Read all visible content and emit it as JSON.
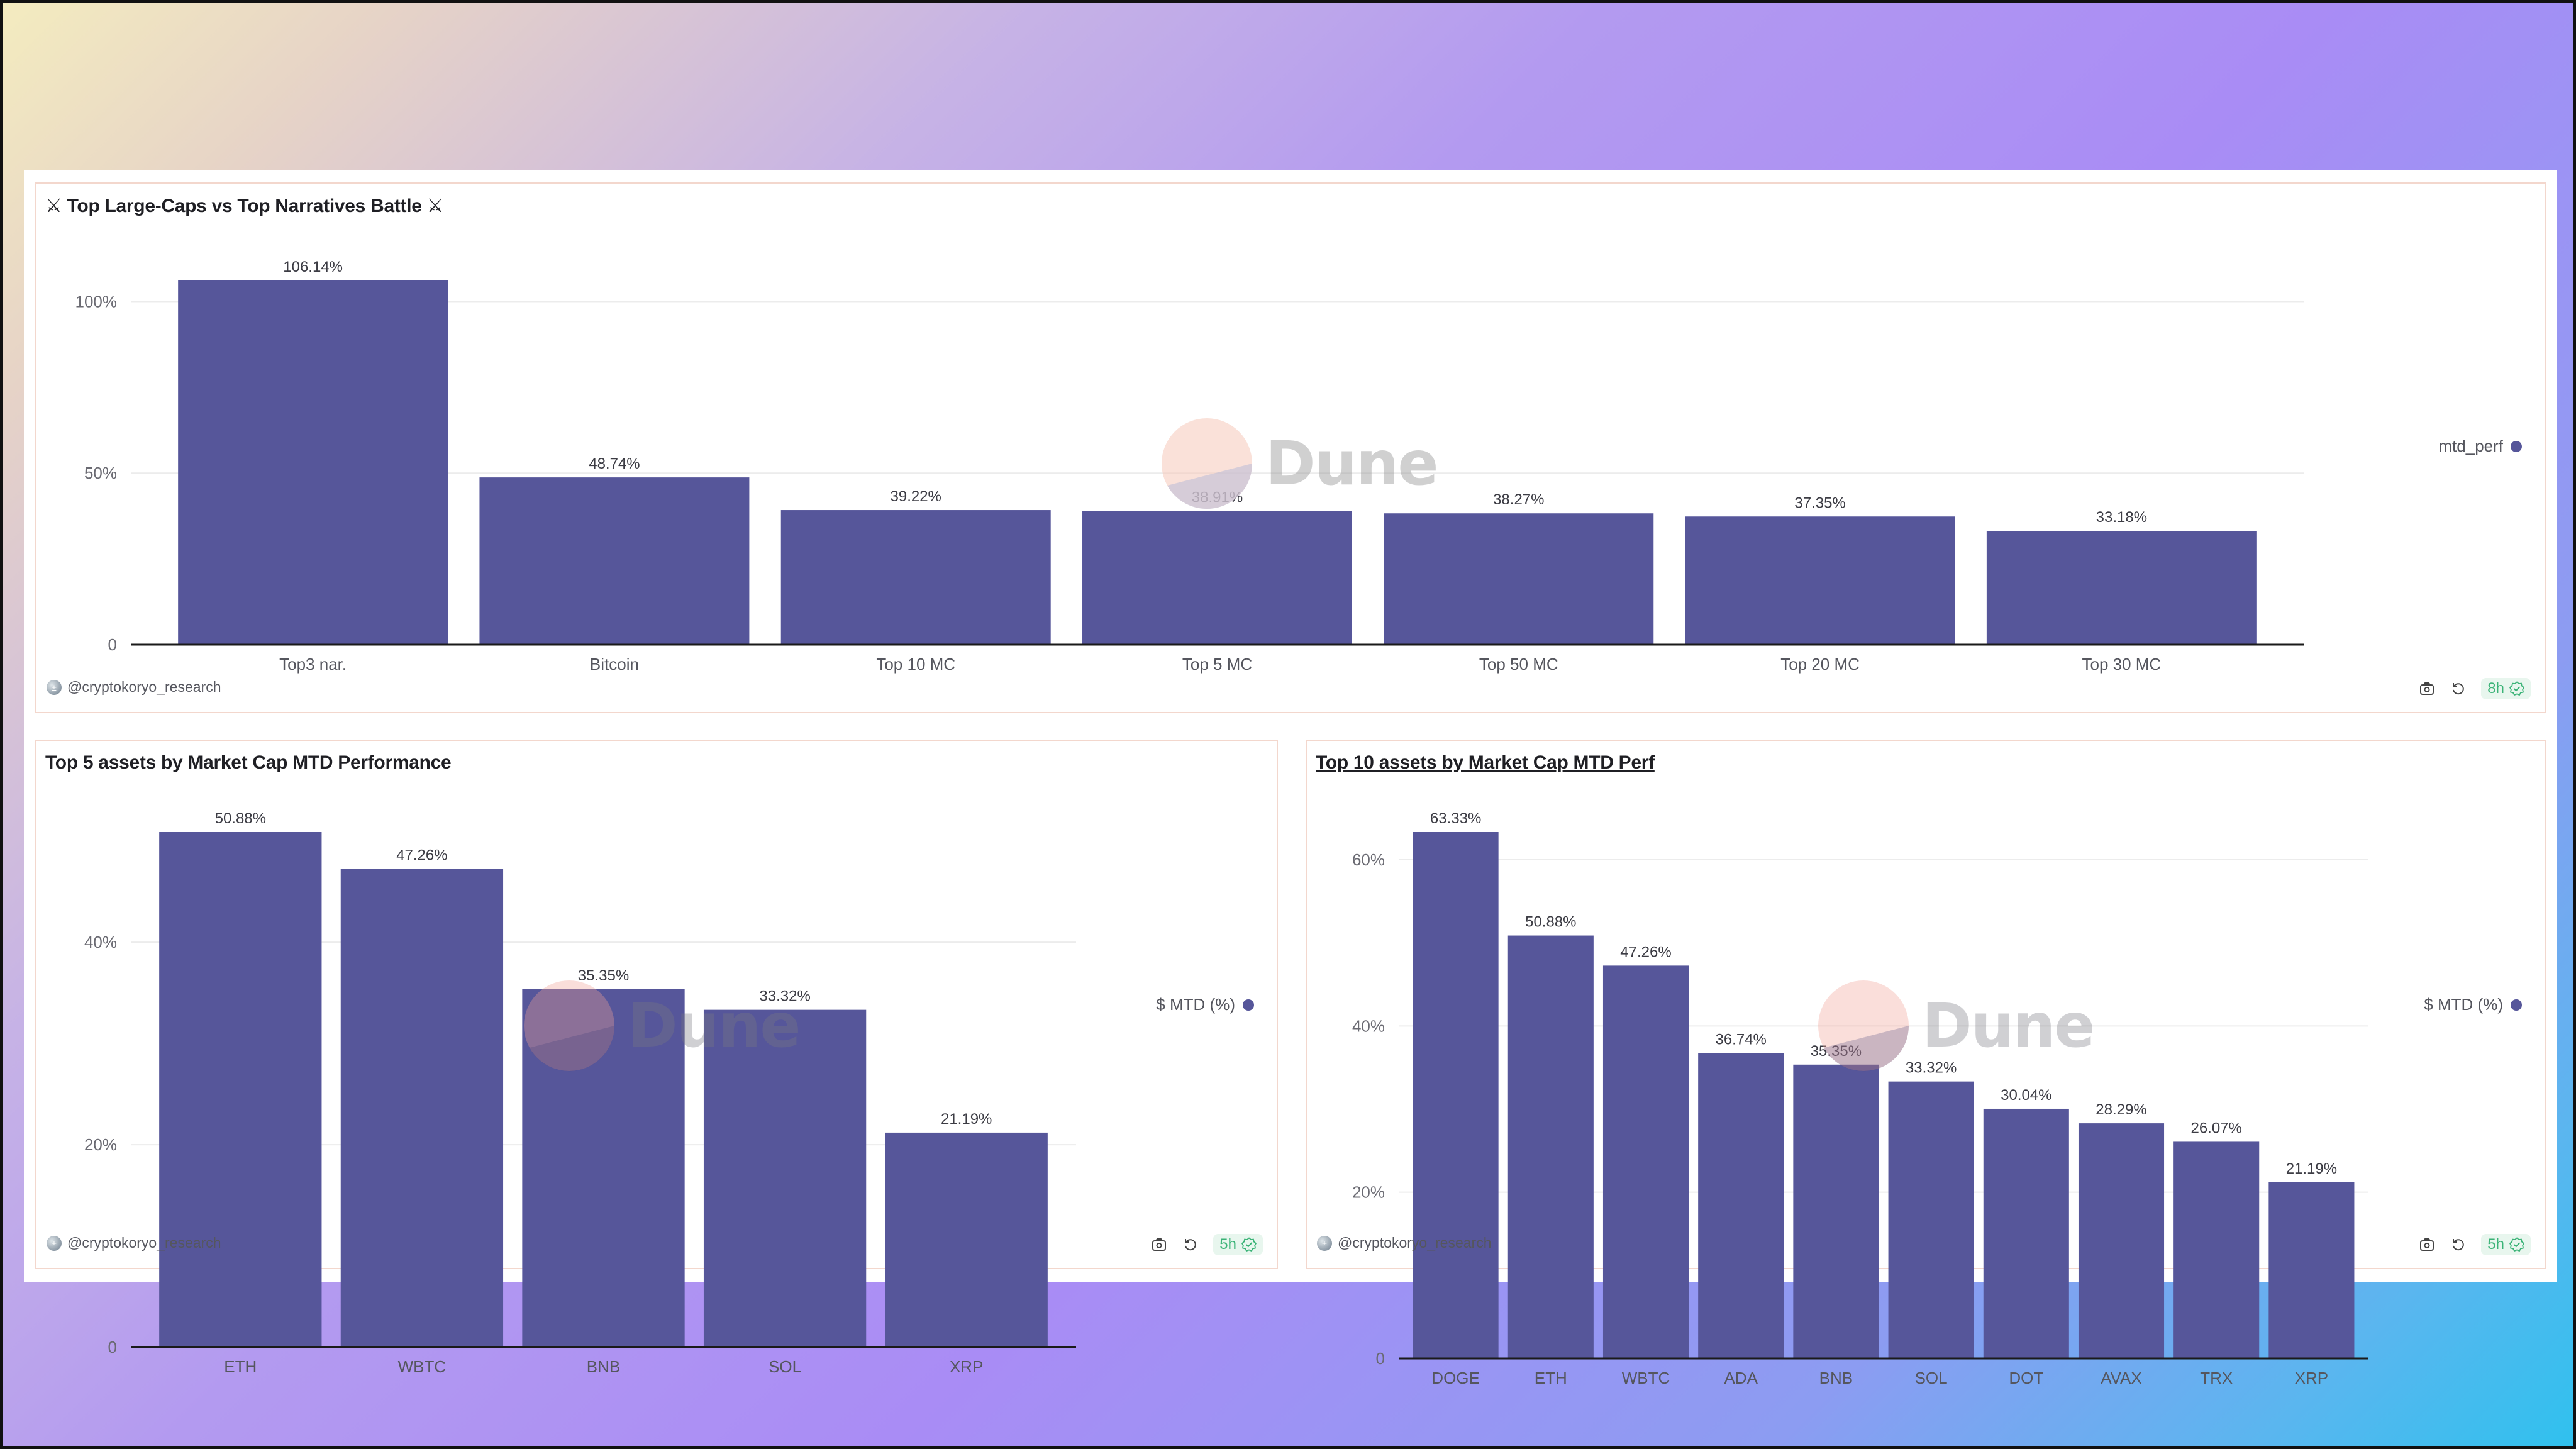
{
  "brand": {
    "bar_color": "#56569a",
    "watermark_text": "Dune",
    "fresh_color": "#3bb377"
  },
  "panels": [
    {
      "title": "⚔ Top Large-Caps vs Top Narratives Battle ⚔",
      "title_is_link": false,
      "author": "@cryptokoryo_research",
      "freshness": "8h",
      "legend_label": "mtd_perf"
    },
    {
      "title": "Top 5 assets by Market Cap MTD Performance",
      "title_is_link": false,
      "author": "@cryptokoryo_research",
      "freshness": "5h",
      "legend_label": "$ MTD (%)"
    },
    {
      "title": "Top 10 assets by Market Cap MTD Perf",
      "title_is_link": true,
      "author": "@cryptokoryo_research",
      "freshness": "5h",
      "legend_label": "$ MTD (%)"
    }
  ],
  "chart_data": [
    {
      "type": "bar",
      "title": "⚔ Top Large-Caps vs Top Narratives Battle ⚔",
      "categories": [
        "Top3 nar.",
        "Bitcoin",
        "Top 10 MC",
        "Top 5 MC",
        "Top 50 MC",
        "Top 20 MC",
        "Top 30 MC"
      ],
      "values": [
        106.14,
        48.74,
        39.22,
        38.91,
        38.27,
        37.35,
        33.18
      ],
      "data_labels": [
        "106.14%",
        "48.74%",
        "39.22%",
        "38.91%",
        "38.27%",
        "37.35%",
        "33.18%"
      ],
      "yticks": [
        0,
        50,
        100
      ],
      "ytick_labels": [
        "0",
        "50%",
        "100%"
      ],
      "ylim": [
        0,
        106.14
      ],
      "xlabel": "",
      "ylabel": "",
      "legend": [
        "mtd_perf"
      ],
      "legend_position": "right",
      "grid": true
    },
    {
      "type": "bar",
      "title": "Top 5 assets by Market Cap MTD Performance",
      "categories": [
        "ETH",
        "WBTC",
        "BNB",
        "SOL",
        "XRP"
      ],
      "values": [
        50.88,
        47.26,
        35.35,
        33.32,
        21.19
      ],
      "data_labels": [
        "50.88%",
        "47.26%",
        "35.35%",
        "33.32%",
        "21.19%"
      ],
      "yticks": [
        0,
        20,
        40
      ],
      "ytick_labels": [
        "0",
        "20%",
        "40%"
      ],
      "ylim": [
        0,
        50.88
      ],
      "xlabel": "",
      "ylabel": "",
      "legend": [
        "$ MTD (%)"
      ],
      "legend_position": "right",
      "grid": true
    },
    {
      "type": "bar",
      "title": "Top 10 assets by Market Cap MTD Perf",
      "categories": [
        "DOGE",
        "ETH",
        "WBTC",
        "ADA",
        "BNB",
        "SOL",
        "DOT",
        "AVAX",
        "TRX",
        "XRP"
      ],
      "values": [
        63.33,
        50.88,
        47.26,
        36.74,
        35.35,
        33.32,
        30.04,
        28.29,
        26.07,
        21.19
      ],
      "data_labels": [
        "63.33%",
        "50.88%",
        "47.26%",
        "36.74%",
        "35.35%",
        "33.32%",
        "30.04%",
        "28.29%",
        "26.07%",
        "21.19%"
      ],
      "yticks": [
        0,
        20,
        40,
        60
      ],
      "ytick_labels": [
        "0",
        "20%",
        "40%",
        "60%"
      ],
      "ylim": [
        0,
        63.33
      ],
      "xlabel": "",
      "ylabel": "",
      "legend": [
        "$ MTD (%)"
      ],
      "legend_position": "right",
      "grid": true
    }
  ]
}
